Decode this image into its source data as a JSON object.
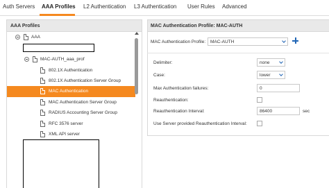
{
  "tabs": [
    {
      "label": "Auth Servers"
    },
    {
      "label": "AAA Profiles"
    },
    {
      "label": "L2 Authentication"
    },
    {
      "label": "L3 Authentication"
    },
    {
      "label": "User Rules"
    },
    {
      "label": "Advanced"
    }
  ],
  "active_tab": "AAA Profiles",
  "left_panel": {
    "title": "AAA Profiles",
    "tree": [
      {
        "label": "AAA",
        "node": "AAA"
      },
      {
        "label": "MAC-AUTH_aaa_prof",
        "node": "MAC-AUTH_aaa_prof"
      },
      {
        "label": "802.1X Authentication"
      },
      {
        "label": "802.1X Authentication Server Group"
      },
      {
        "label": "MAC Authentication",
        "selected": true
      },
      {
        "label": "MAC Authentication Server Group"
      },
      {
        "label": "RADIUS Accounting Server Group"
      },
      {
        "label": "RFC 3576 server"
      },
      {
        "label": "XML API server"
      }
    ]
  },
  "right_panel": {
    "title": "MAC Authentication Profile: MAC-AUTH",
    "profile_label": "MAC Authentication Profile:",
    "profile_value": "MAC-AUTH",
    "fields": {
      "delimiter_label": "Delimiter:",
      "delimiter_value": "none",
      "case_label": "Case:",
      "case_value": "lower",
      "max_failures_label": "Max Authentication failures:",
      "max_failures_value": "0",
      "reauth_label": "Reauthentication:",
      "reauth_checked": false,
      "reauth_interval_label": "Reauthentication Interval:",
      "reauth_interval_value": "86400",
      "reauth_interval_unit": "sec",
      "server_reauth_label": "Use Server provided Reauthentication Interval:",
      "server_reauth_checked": false
    }
  },
  "colors": {
    "accent": "#f5891f",
    "link_blue": "#2166b5"
  },
  "icons": [
    "collapse-icon",
    "document-icon",
    "chevron-down-icon",
    "plus-icon",
    "scroll-up-icon"
  ]
}
